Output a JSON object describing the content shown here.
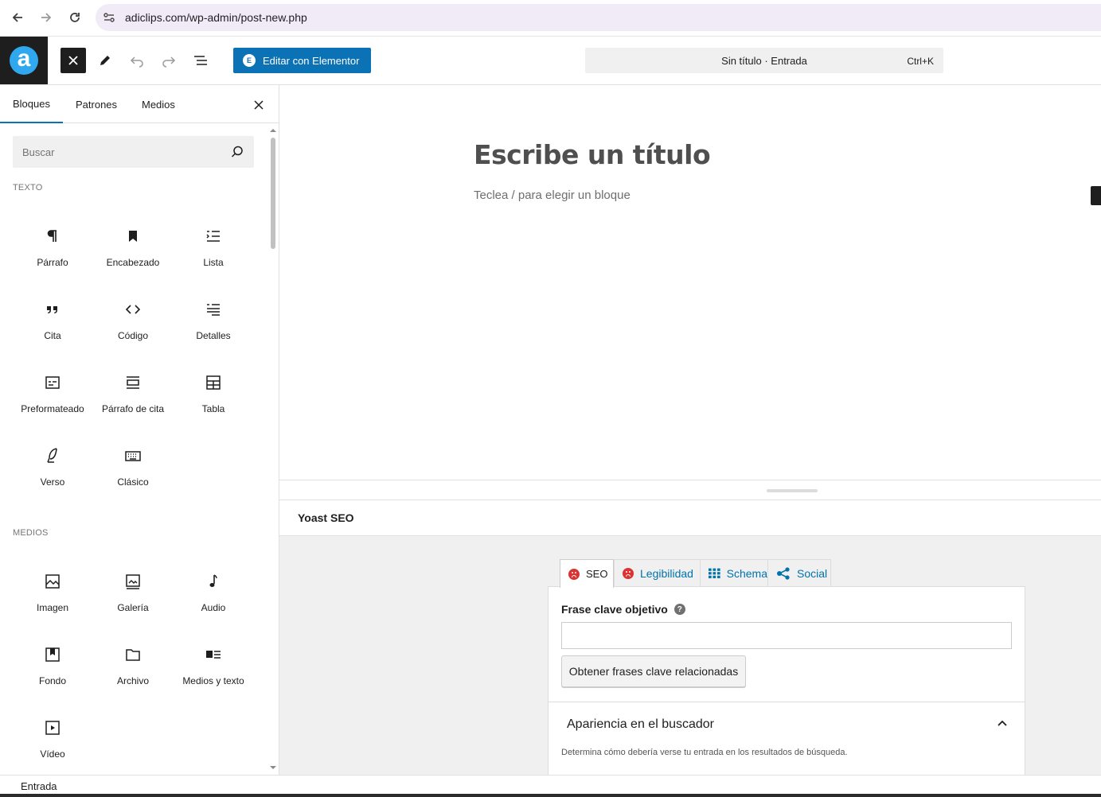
{
  "browser": {
    "url": "adiclips.com/wp-admin/post-new.php"
  },
  "header": {
    "elementor_label": "Editar con Elementor",
    "command_title": "Sin título · Entrada",
    "command_shortcut": "Ctrl+K",
    "logo_letter": "a"
  },
  "sidebar": {
    "tabs": [
      {
        "label": "Bloques",
        "active": true
      },
      {
        "label": "Patrones",
        "active": false
      },
      {
        "label": "Medios",
        "active": false
      }
    ],
    "search_placeholder": "Buscar",
    "categories": [
      {
        "title": "TEXTO",
        "blocks": [
          {
            "label": "Párrafo",
            "icon": "paragraph-icon"
          },
          {
            "label": "Encabezado",
            "icon": "bookmark-icon"
          },
          {
            "label": "Lista",
            "icon": "list-icon"
          },
          {
            "label": "Cita",
            "icon": "quote-icon"
          },
          {
            "label": "Código",
            "icon": "code-icon"
          },
          {
            "label": "Detalles",
            "icon": "details-icon"
          },
          {
            "label": "Preformateado",
            "icon": "preformatted-icon"
          },
          {
            "label": "Párrafo de cita",
            "icon": "pullquote-icon"
          },
          {
            "label": "Tabla",
            "icon": "table-icon"
          },
          {
            "label": "Verso",
            "icon": "verse-icon"
          },
          {
            "label": "Clásico",
            "icon": "keyboard-icon"
          }
        ]
      },
      {
        "title": "MEDIOS",
        "blocks": [
          {
            "label": "Imagen",
            "icon": "image-icon"
          },
          {
            "label": "Galería",
            "icon": "gallery-icon"
          },
          {
            "label": "Audio",
            "icon": "audio-icon"
          },
          {
            "label": "Fondo",
            "icon": "cover-icon"
          },
          {
            "label": "Archivo",
            "icon": "folder-icon"
          },
          {
            "label": "Medios y texto",
            "icon": "media-text-icon"
          },
          {
            "label": "Vídeo",
            "icon": "video-icon"
          }
        ]
      }
    ]
  },
  "canvas": {
    "title_placeholder": "Escribe un título",
    "block_prompt": "Teclea / para elegir un bloque"
  },
  "yoast": {
    "heading": "Yoast SEO",
    "tabs": [
      {
        "label": "SEO",
        "icon": "sad-face-icon",
        "active": true
      },
      {
        "label": "Legibilidad",
        "icon": "sad-face-icon",
        "active": false
      },
      {
        "label": "Schema",
        "icon": "grid-icon",
        "active": false
      },
      {
        "label": "Social",
        "icon": "share-icon",
        "active": false
      }
    ],
    "keyphrase_label": "Frase clave objetivo",
    "keyphrase_value": "",
    "related_button": "Obtener frases clave relacionadas",
    "snippet_title": "Apariencia en el buscador",
    "snippet_desc": "Determina cómo debería verse tu entrada en los resultados de búsqueda.",
    "colors": {
      "tab_link": "#0073aa",
      "bad_score": "#dc3232"
    }
  },
  "status": {
    "breadcrumb": "Entrada"
  },
  "colors": {
    "accent": "#0b72b5",
    "dark": "#1e1e1e"
  }
}
